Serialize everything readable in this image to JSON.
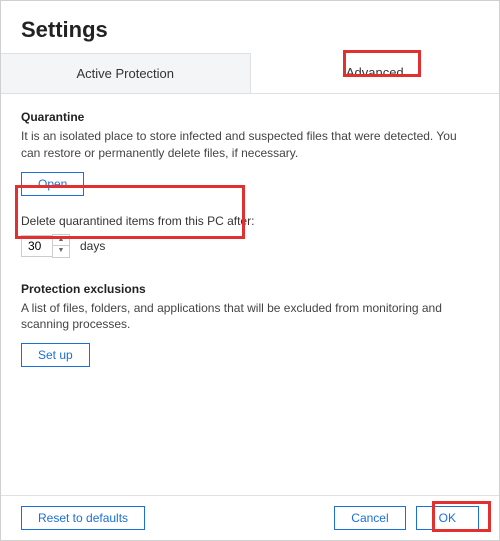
{
  "header": {
    "title": "Settings"
  },
  "tabs": {
    "active_protection": "Active Protection",
    "advanced": "Advanced"
  },
  "quarantine": {
    "title": "Quarantine",
    "desc": "It is an isolated place to store infected and suspected files that were detected. You can restore or permanently delete files, if necessary.",
    "open_label": "Open",
    "delete_label": "Delete quarantined items from this PC after:",
    "delete_value": "30",
    "days_label": "days"
  },
  "exclusions": {
    "title": "Protection exclusions",
    "desc": "A list of files, folders, and applications that will be excluded from monitoring and scanning processes.",
    "setup_label": "Set up"
  },
  "footer": {
    "reset_label": "Reset to defaults",
    "cancel_label": "Cancel",
    "ok_label": "OK"
  }
}
